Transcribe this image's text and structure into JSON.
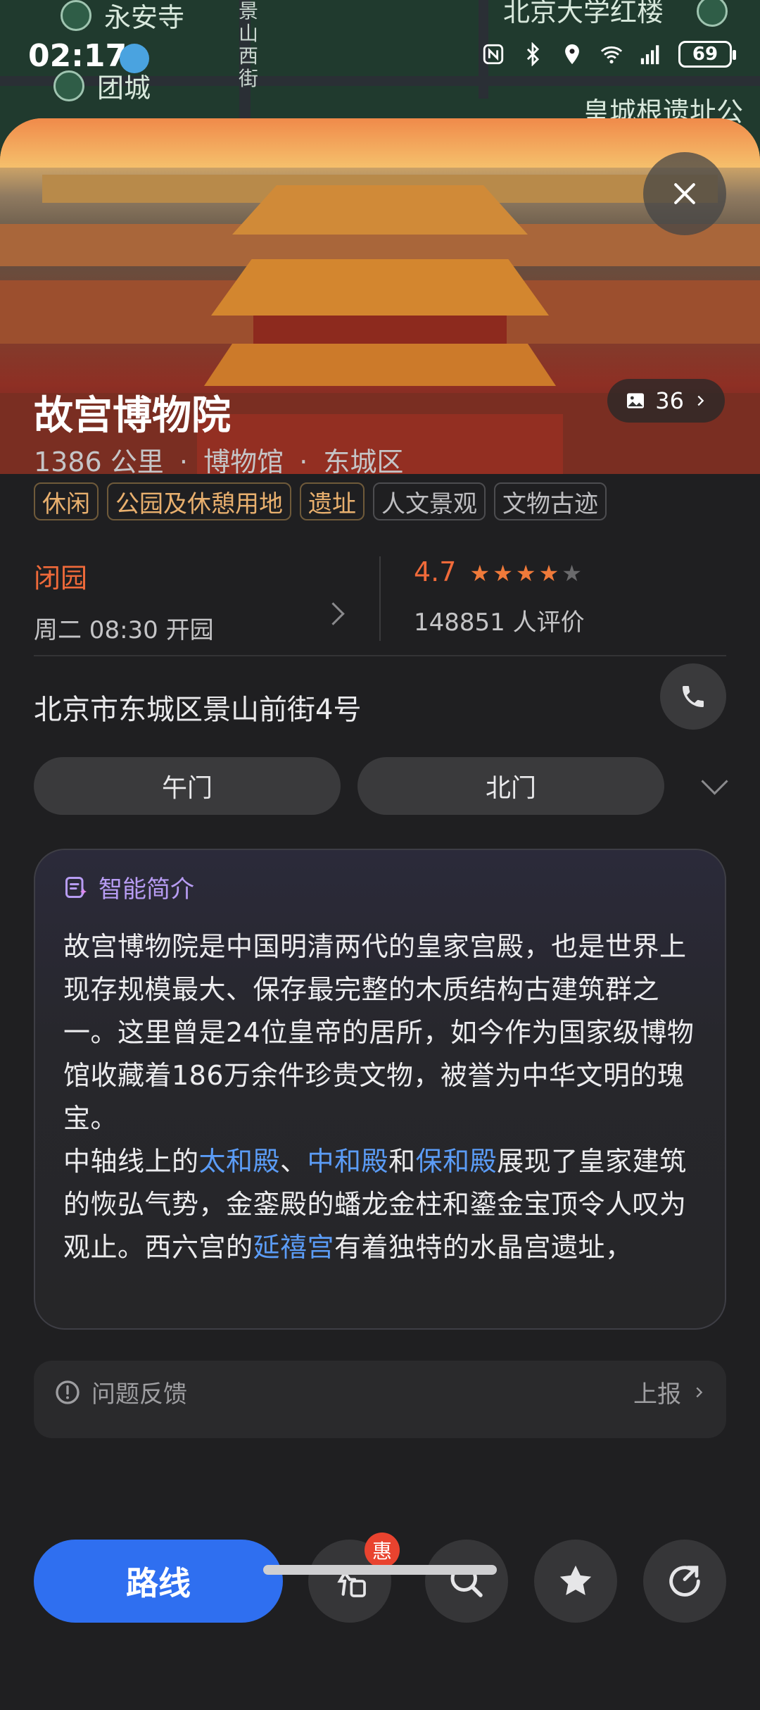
{
  "status_bar": {
    "time": "02:17",
    "battery": "69",
    "icons": [
      "nfc-icon",
      "bluetooth-icon",
      "location-icon",
      "wifi-icon",
      "signal-icon"
    ]
  },
  "map": {
    "labels": [
      "永安寺",
      "北京大学红楼",
      "团城",
      "皇城根遗址公",
      "景山西街"
    ]
  },
  "hero": {
    "photo_count": "36"
  },
  "place": {
    "name": "故宫博物院",
    "distance": "1386 公里",
    "category": "博物馆",
    "district": "东城区",
    "separator": "·",
    "tags": [
      {
        "label": "休闲",
        "style": "warm"
      },
      {
        "label": "公园及休憩用地",
        "style": "warm"
      },
      {
        "label": "遗址",
        "style": "warm"
      },
      {
        "label": "人文景观",
        "style": "gray"
      },
      {
        "label": "文物古迹",
        "style": "gray"
      }
    ]
  },
  "hours": {
    "status": "闭园",
    "next_open": "周二 08:30 开园"
  },
  "rating": {
    "score": "4.7",
    "stars_filled": 4,
    "stars_total": 5,
    "reviews": "148851 人评价"
  },
  "address": "北京市东城区景山前街4号",
  "gates": [
    "午门",
    "北门"
  ],
  "intro": {
    "heading": "智能简介",
    "para1": "故宫博物院是中国明清两代的皇家宫殿，也是世界上现存规模最大、保存最完整的木质结构古建筑群之一。这里曾是24位皇帝的居所，如今作为国家级博物馆收藏着186万余件珍贵文物，被誉为中华文明的瑰宝。",
    "para2_prefix": "中轴线上的",
    "link1": "太和殿",
    "sep1": "、",
    "link2": "中和殿",
    "sep2": "和",
    "link3": "保和殿",
    "para2_mid": "展现了皇家建筑的恢弘气势，金銮殿的蟠龙金柱和鎏金宝顶令人叹为观止。西六宫的",
    "link4": "延禧宫",
    "para2_suffix": "有着独特的水晶宫遗址，"
  },
  "feedback": {
    "label": "问题反馈",
    "action": "上报"
  },
  "bottom_bar": {
    "route_label": "路线",
    "badge": "惠"
  },
  "colors": {
    "accent_blue": "#2f6ff0",
    "status_orange": "#f06a3a",
    "link_blue": "#5b9cf6",
    "ai_purple": "#b79cf3"
  }
}
